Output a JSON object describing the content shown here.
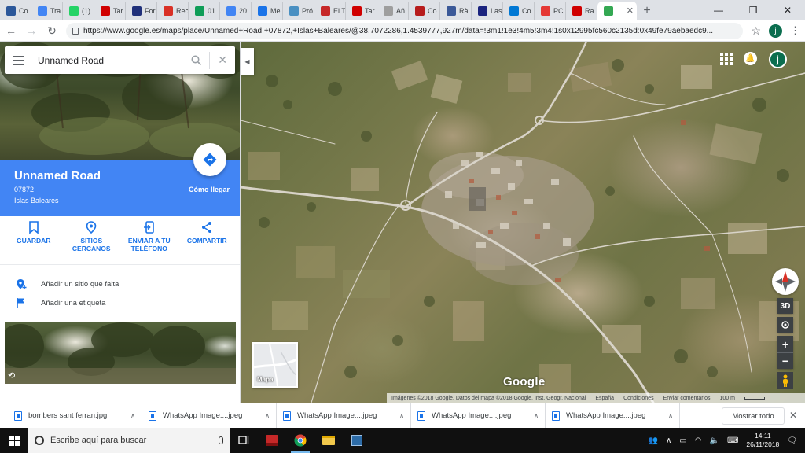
{
  "browser": {
    "tabs": [
      {
        "label": "Co",
        "color": "#2b579a"
      },
      {
        "label": "Tra",
        "color": "#4285f4"
      },
      {
        "label": "(1)",
        "color": "#25d366"
      },
      {
        "label": "Tar",
        "color": "#d00000"
      },
      {
        "label": "For",
        "color": "#20307a"
      },
      {
        "label": "Rec",
        "color": "#d93025"
      },
      {
        "label": "01",
        "color": "#0f9d58"
      },
      {
        "label": "20",
        "color": "#4285f4"
      },
      {
        "label": "Me",
        "color": "#1a73e8"
      },
      {
        "label": "Pró",
        "color": "#4a90c2"
      },
      {
        "label": "El T",
        "color": "#c62828"
      },
      {
        "label": "Tar",
        "color": "#d00000"
      },
      {
        "label": "Añ",
        "color": "#9e9e9e"
      },
      {
        "label": "Co",
        "color": "#b71c1c"
      },
      {
        "label": "Rà",
        "color": "#3b5998"
      },
      {
        "label": "Las",
        "color": "#1a237e"
      },
      {
        "label": "Co",
        "color": "#0078d4"
      },
      {
        "label": "PC",
        "color": "#e53935"
      },
      {
        "label": "Ra",
        "color": "#d00000"
      }
    ],
    "active_tab_color": "#34a853",
    "new_tab": "+",
    "url": "https://www.google.es/maps/place/Unnamed+Road,+07872,+Islas+Baleares/@38.7072286,1.4539777,927m/data=!3m1!1e3!4m5!3m4!1s0x12995fc560c2135d:0x49fe79aebaedc9...",
    "profile_initial": "j"
  },
  "search": {
    "value": "Unnamed Road"
  },
  "place": {
    "title": "Unnamed Road",
    "zip": "07872",
    "region": "Islas Baleares",
    "directions_label": "Cómo llegar"
  },
  "actions": [
    {
      "label": "GUARDAR",
      "icon": "bookmark-icon"
    },
    {
      "label": "SITIOS CERCANOS",
      "icon": "nearby-pin-icon"
    },
    {
      "label": "ENVIAR A TU TELÉFONO",
      "icon": "send-to-phone-icon"
    },
    {
      "label": "COMPARTIR",
      "icon": "share-icon"
    }
  ],
  "extra": {
    "add_place": "Añadir un sitio que falta",
    "add_label": "Añadir una etiqueta"
  },
  "map": {
    "minimap_label": "Mapa",
    "logo": "Google",
    "btn_3d": "3D",
    "attribution": "Imágenes ©2018 Google, Datos del mapa ©2018 Google, Inst. Geogr. Nacional",
    "country": "España",
    "terms": "Condiciones",
    "feedback": "Enviar comentarios",
    "scale": "100 m",
    "profile_initial": "j"
  },
  "downloads": {
    "items": [
      "bombers sant ferran.jpg",
      "WhatsApp Image....jpeg",
      "WhatsApp Image....jpeg",
      "WhatsApp Image....jpeg",
      "WhatsApp Image....jpeg"
    ],
    "show_all": "Mostrar todo"
  },
  "taskbar": {
    "search_placeholder": "Escribe aquí para buscar",
    "time": "14:11",
    "date": "26/11/2018"
  }
}
